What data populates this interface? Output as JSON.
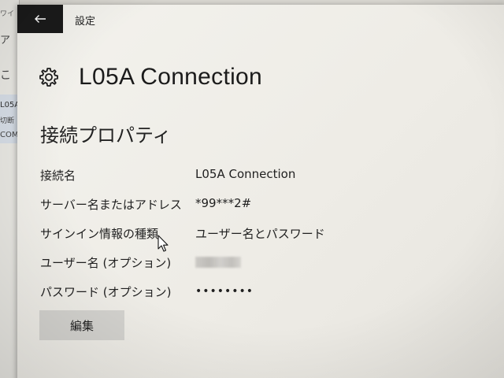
{
  "background_window": {
    "fragments": [
      "ワイ",
      "ア",
      "こ",
      "L05A",
      "切断",
      "COM"
    ]
  },
  "titlebar": {
    "back_icon": "arrow-left-icon",
    "title": "設定"
  },
  "header": {
    "icon": "gear-icon",
    "title": "L05A Connection"
  },
  "section": {
    "title": "接続プロパティ"
  },
  "properties": [
    {
      "label": "接続名",
      "value": "L05A Connection"
    },
    {
      "label": "サーバー名またはアドレス",
      "value": "*99***2#"
    },
    {
      "label": "サインイン情報の種類",
      "value": "ユーザー名とパスワード"
    },
    {
      "label": "ユーザー名 (オプション)",
      "value": ""
    },
    {
      "label": "パスワード (オプション)",
      "value": "••••••••"
    }
  ],
  "actions": {
    "edit_label": "編集"
  },
  "colors": {
    "back_button_bg": "#1a1a1a",
    "window_bg": "#f0efea",
    "button_bg": "#d4d3cf"
  }
}
